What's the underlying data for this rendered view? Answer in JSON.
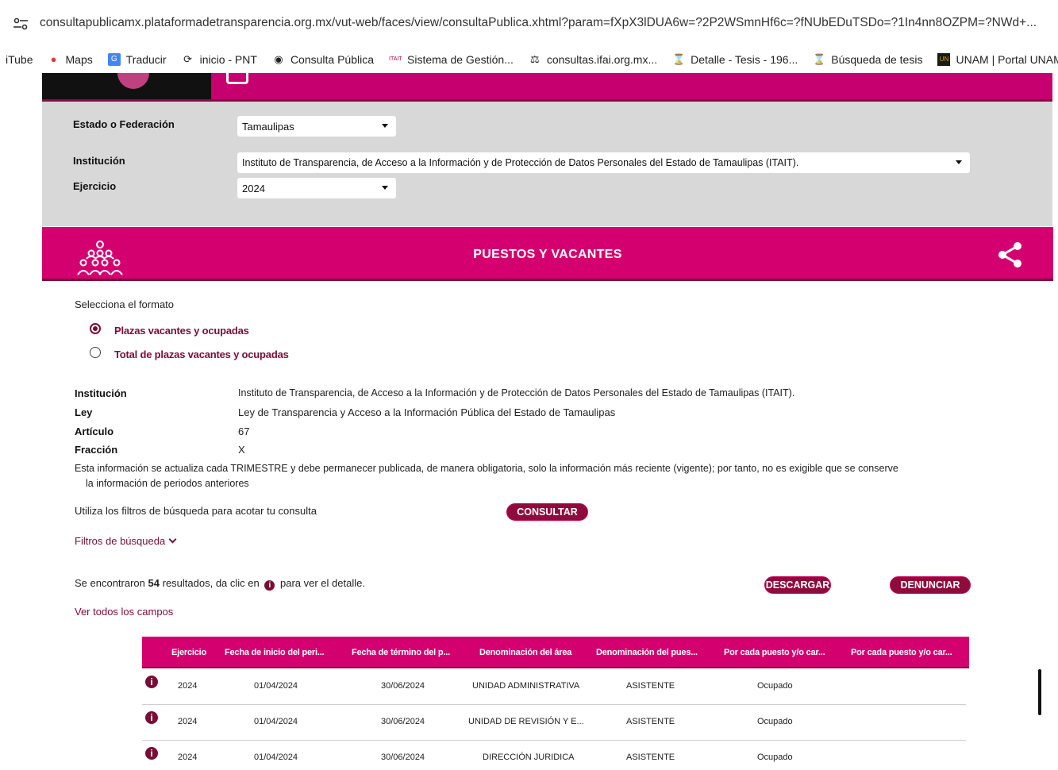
{
  "browser": {
    "url": "consultapublicamx.plataformadetransparencia.org.mx/vut-web/faces/view/consultaPublica.xhtml?param=fXpX3lDUA6w=?2P2WSmnHf6c=?fNUbEDuTSDo=?1In4nn8OZPM=?NWd+...",
    "bookmarks": [
      {
        "label": "iTube",
        "icon": "youtube-icon"
      },
      {
        "label": "Maps",
        "icon": "maps-pin-icon"
      },
      {
        "label": "Traducir",
        "icon": "translate-icon"
      },
      {
        "label": "inicio - PNT",
        "icon": "pnt-icon"
      },
      {
        "label": "Consulta Pública",
        "icon": "globe-icon"
      },
      {
        "label": "Sistema de Gestión...",
        "icon": "itait-icon"
      },
      {
        "label": "consultas.ifai.org.mx...",
        "icon": "building-icon"
      },
      {
        "label": "Detalle - Tesis - 196...",
        "icon": "scale-icon"
      },
      {
        "label": "Búsqueda de tesis",
        "icon": "scale-icon"
      },
      {
        "label": "UNAM | Portal UNAM",
        "icon": "unam-icon"
      }
    ]
  },
  "filters": {
    "estado_label": "Estado o Federación",
    "estado_value": "Tamaulipas",
    "institucion_label": "Institución",
    "institucion_value": "Instituto de Transparencia, de Acceso a la Información y de Protección de Datos Personales del Estado de Tamaulipas (ITAIT).",
    "ejercicio_label": "Ejercicio",
    "ejercicio_value": "2024"
  },
  "section": {
    "title": "PUESTOS Y VACANTES"
  },
  "formato": {
    "prompt": "Selecciona el formato",
    "options": [
      {
        "label": "Plazas vacantes y ocupadas",
        "selected": true
      },
      {
        "label": "Total de plazas vacantes y ocupadas",
        "selected": false
      }
    ]
  },
  "meta": {
    "institucion_label": "Institución",
    "institucion_value": "Instituto de Transparencia, de Acceso a la Información y de Protección de Datos Personales del Estado de Tamaulipas (ITAIT).",
    "ley_label": "Ley",
    "ley_value": "Ley de Transparencia y Acceso a la Información Pública del Estado de Tamaulipas",
    "articulo_label": "Artículo",
    "articulo_value": "67",
    "fraccion_label": "Fracción",
    "fraccion_value": "X",
    "nota_line1": "Esta información se actualiza cada TRIMESTRE y debe permanecer publicada, de manera obligatoria, solo la información más reciente (vigente); por tanto, no es exigible que se conserve",
    "nota_line2": "la información de periodos anteriores"
  },
  "search": {
    "hint": "Utiliza los filtros de búsqueda para acotar tu consulta",
    "consultar_label": "CONSULTAR",
    "filtros_label": "Filtros de búsqueda"
  },
  "results": {
    "prefix": "Se encontraron",
    "count": "54",
    "middle": "resultados, da clic en",
    "suffix": "para ver el detalle.",
    "descargar_label": "DESCARGAR",
    "denunciar_label": "DENUNCIAR",
    "ver_todos_label": "Ver todos los campos"
  },
  "table": {
    "columns": [
      "Ejercicio",
      "Fecha de inicio del peri...",
      "Fecha de término del p...",
      "Denominación del área",
      "Denominación del pues...",
      "Por cada puesto y/o car...",
      "Por cada puesto y/o car..."
    ],
    "rows": [
      [
        "2024",
        "01/04/2024",
        "30/06/2024",
        "UNIDAD ADMINISTRATIVA",
        "ASISTENTE",
        "Ocupado"
      ],
      [
        "2024",
        "01/04/2024",
        "30/06/2024",
        "UNIDAD DE REVISIÓN Y E...",
        "ASISTENTE",
        "Ocupado"
      ],
      [
        "2024",
        "01/04/2024",
        "30/06/2024",
        "DIRECCIÓN JURIDICA",
        "ASISTENTE",
        "Ocupado"
      ]
    ]
  },
  "colors": {
    "magenta": "#d4006f",
    "maroon": "#7a0c35",
    "panel_gray": "#d8d8d8"
  }
}
